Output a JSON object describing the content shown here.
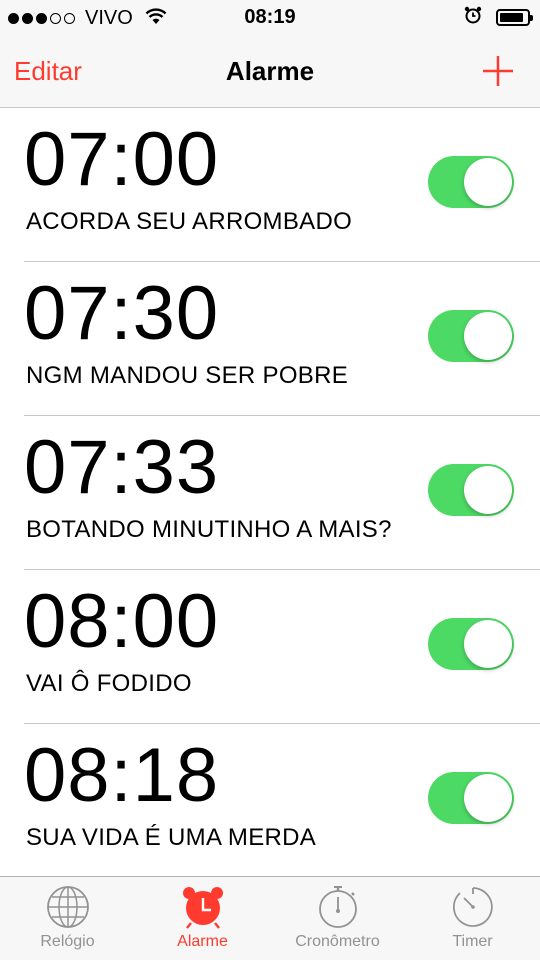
{
  "status_bar": {
    "signal_filled": 3,
    "signal_total": 5,
    "carrier": "VIVO",
    "time": "08:19",
    "battery_level": 0.88
  },
  "nav": {
    "edit_label": "Editar",
    "title": "Alarme",
    "add_icon": "plus-icon",
    "accent_color": "#ff3b30"
  },
  "alarms": [
    {
      "time": "07:00",
      "label": "ACORDA SEU ARROMBADO",
      "enabled": true
    },
    {
      "time": "07:30",
      "label": "NGM MANDOU SER POBRE",
      "enabled": true
    },
    {
      "time": "07:33",
      "label": "BOTANDO MINUTINHO A MAIS?",
      "enabled": true
    },
    {
      "time": "08:00",
      "label": "VAI Ô FODIDO",
      "enabled": true
    },
    {
      "time": "08:18",
      "label": "SUA VIDA É UMA MERDA",
      "enabled": true
    }
  ],
  "toggle_on_color": "#4cd964",
  "tabs": [
    {
      "label": "Relógio",
      "icon": "globe-icon",
      "active": false
    },
    {
      "label": "Alarme",
      "icon": "alarm-clock-icon",
      "active": true
    },
    {
      "label": "Cronômetro",
      "icon": "stopwatch-icon",
      "active": false
    },
    {
      "label": "Timer",
      "icon": "timer-icon",
      "active": false
    }
  ]
}
